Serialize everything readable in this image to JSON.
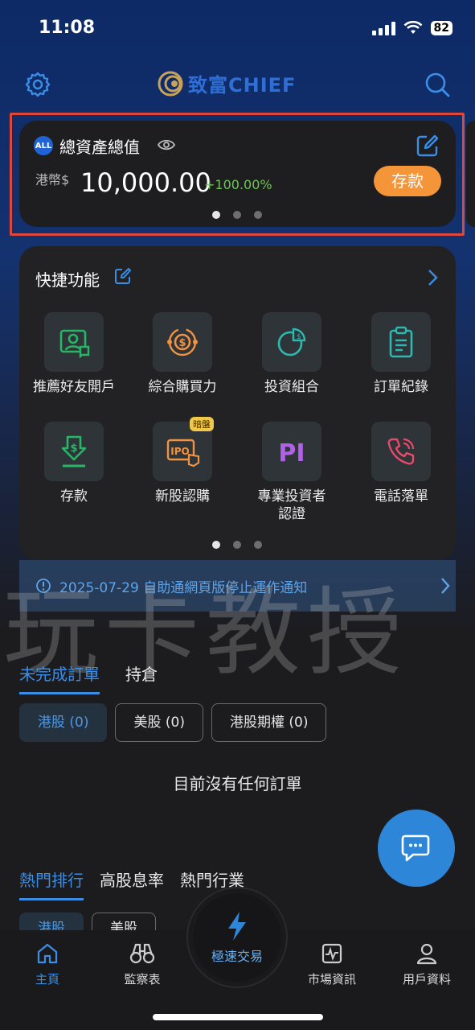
{
  "status": {
    "time": "11:08",
    "battery": "82"
  },
  "header": {
    "logo_text": "致富CHIEF"
  },
  "asset": {
    "badge": "ALL",
    "title": "總資產總值",
    "currency": "港幣$",
    "amount": "10,000.00",
    "change": "+100.00%",
    "deposit_label": "存款"
  },
  "quick": {
    "title": "快捷功能",
    "items": [
      {
        "label": "推薦好友開戶",
        "icon": "refer-friend-icon"
      },
      {
        "label": "綜合購買力",
        "icon": "buying-power-icon"
      },
      {
        "label": "投資組合",
        "icon": "portfolio-icon"
      },
      {
        "label": "訂單紀錄",
        "icon": "order-record-icon"
      },
      {
        "label": "存款",
        "icon": "deposit-icon"
      },
      {
        "label": "新股認購",
        "icon": "ipo-icon",
        "badge": "暗盤"
      },
      {
        "label": "專業投資者\n認證",
        "icon": "pi-icon"
      },
      {
        "label": "電話落單",
        "icon": "phone-order-icon"
      }
    ]
  },
  "notice": {
    "text": "2025-07-29 自助通網頁版停止運作通知"
  },
  "watermark": "玩卡教授",
  "orders": {
    "tabs": [
      "未完成訂單",
      "持倉"
    ],
    "pills": [
      "港股 (0)",
      "美股 (0)",
      "港股期權 (0)"
    ],
    "empty": "目前沒有任何訂單"
  },
  "rankings": {
    "tabs": [
      "熱門排行",
      "高股息率",
      "熱門行業"
    ],
    "pills": [
      "港股",
      "美股"
    ]
  },
  "nav": {
    "items": [
      "主頁",
      "監察表",
      "市場資訊",
      "用戶資料"
    ],
    "center": "極速交易"
  },
  "colors": {
    "accent": "#3a8ee6",
    "deposit": "#f5953a",
    "positive": "#6cc64f",
    "highlight": "#e0463a"
  }
}
